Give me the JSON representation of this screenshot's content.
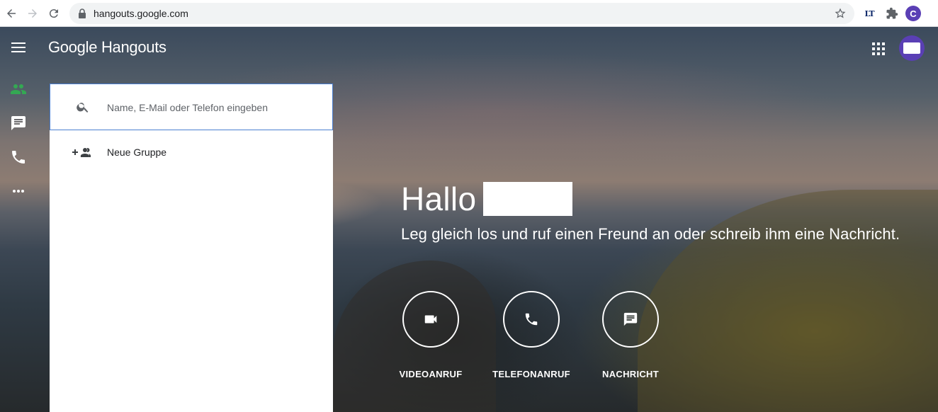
{
  "browser": {
    "url": "hangouts.google.com",
    "extension_lt_label": "LT",
    "profile_initial": "C"
  },
  "app": {
    "logo_text": "Google Hangouts",
    "search": {
      "placeholder": "Name, E-Mail oder Telefon eingeben"
    },
    "new_group_label": "Neue Gruppe",
    "greeting": "Hallo",
    "subtitle": "Leg gleich los und ruf einen Freund an oder schreib ihm eine Nachricht.",
    "actions": [
      {
        "label": "VIDEOANRUF",
        "icon": "videocam-icon"
      },
      {
        "label": "TELEFONANRUF",
        "icon": "phone-icon"
      },
      {
        "label": "NACHRICHT",
        "icon": "message-icon"
      }
    ],
    "rail": [
      "contacts-icon",
      "chat-icon",
      "phone-icon",
      "more-icon"
    ],
    "colors": {
      "accent_green": "#34a853",
      "avatar_purple": "#5a3fb5",
      "search_border": "#4a7fd1"
    }
  }
}
